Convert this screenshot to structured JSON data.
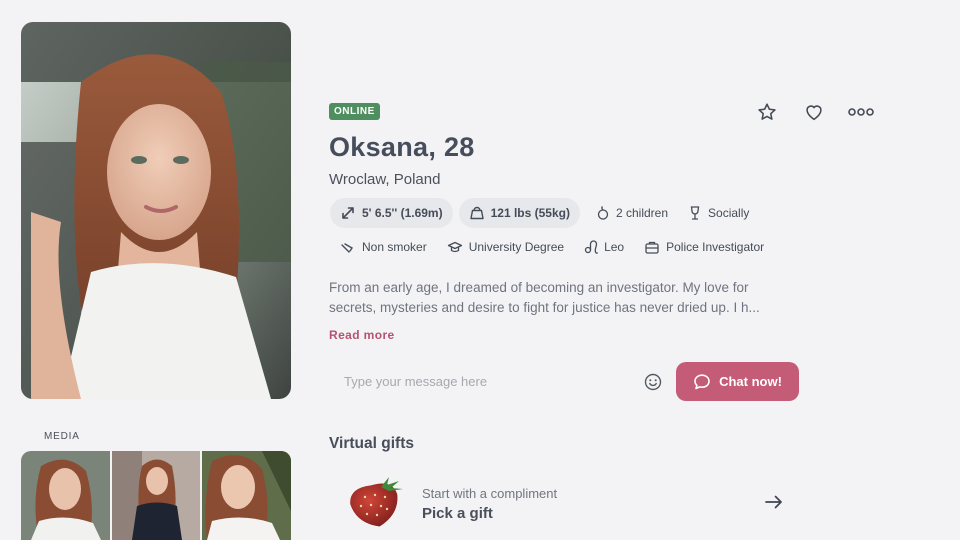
{
  "profile": {
    "status": "ONLINE",
    "name": "Oksana, 28",
    "location": "Wroclaw, Poland",
    "attributes_row1": [
      {
        "icon": "height-arrows-icon",
        "label": "5' 6.5'' (1.69m)",
        "style": "pill"
      },
      {
        "icon": "weight-icon",
        "label": "121 lbs (55kg)",
        "style": "pill"
      },
      {
        "icon": "children-icon",
        "label": "2 children",
        "style": "plain"
      },
      {
        "icon": "wine-glass-icon",
        "label": "Socially",
        "style": "plain"
      }
    ],
    "attributes_row2": [
      {
        "icon": "no-smoking-icon",
        "label": "Non smoker"
      },
      {
        "icon": "graduation-cap-icon",
        "label": "University Degree"
      },
      {
        "icon": "zodiac-leo-icon",
        "label": "Leo"
      },
      {
        "icon": "briefcase-icon",
        "label": "Police Investigator"
      }
    ],
    "bio_line1": "From an early age, I dreamed of becoming an investigator. My love for",
    "bio_line2": "secrets, mysteries and desire to fight for justice has never dried up. I h...",
    "read_more": "Read more"
  },
  "actions": {
    "favorite_icon": "star-icon",
    "like_icon": "heart-icon",
    "more_icon": "more-dots-icon"
  },
  "media": {
    "label": "MEDIA"
  },
  "chat": {
    "placeholder": "Type your message here",
    "button_label": "Chat now!",
    "emoji_icon": "smile-icon"
  },
  "gifts": {
    "title": "Virtual gifts",
    "subtitle": "Start with a compliment",
    "cta": "Pick a gift",
    "gift_icon": "strawberry-icon"
  },
  "colors": {
    "background": "#f3f3f5",
    "accent": "#c45c78",
    "online": "#4f8f5f",
    "pill": "#e7e8ec"
  }
}
